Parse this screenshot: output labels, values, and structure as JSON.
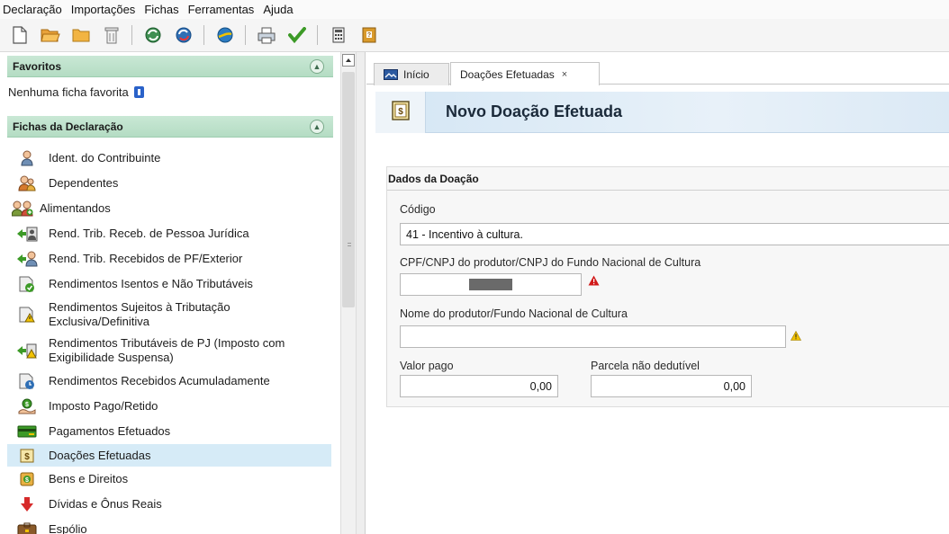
{
  "menu": [
    "Declaração",
    "Importações",
    "Fichas",
    "Ferramentas",
    "Ajuda"
  ],
  "toolbar": {
    "icons": [
      "new-file-icon",
      "open-folder-icon",
      "folder-icon",
      "trash-icon",
      "sync-icon",
      "sync-alt-icon",
      "transmit-icon",
      "print-icon",
      "check-icon",
      "calculator-icon",
      "help-book-icon"
    ]
  },
  "sidebar": {
    "favorites_header": "Favoritos",
    "favorites_empty": "Nenhuma ficha favorita",
    "fichas_header": "Fichas da Declaração",
    "items": [
      {
        "label": "Ident. do Contribuinte",
        "icon": "person-icon"
      },
      {
        "label": "Dependentes",
        "icon": "dependents-icon"
      },
      {
        "label": "Alimentandos",
        "icon": "alimentandos-icon"
      },
      {
        "label": "Rend. Trib. Receb. de Pessoa Jurídica",
        "icon": "income-pj-icon"
      },
      {
        "label": "Rend. Trib. Recebidos de PF/Exterior",
        "icon": "income-pf-icon"
      },
      {
        "label": "Rendimentos Isentos e Não Tributáveis",
        "icon": "exempt-income-icon"
      },
      {
        "label": "Rendimentos Sujeitos à Tributação Exclusiva/Definitiva",
        "icon": "exclusive-income-icon"
      },
      {
        "label": "Rendimentos Tributáveis de PJ (Imposto com Exigibilidade Suspensa)",
        "icon": "suspended-income-icon"
      },
      {
        "label": "Rendimentos Recebidos Acumuladamente",
        "icon": "accumulated-income-icon"
      },
      {
        "label": "Imposto Pago/Retido",
        "icon": "tax-paid-icon"
      },
      {
        "label": "Pagamentos Efetuados",
        "icon": "payments-icon"
      },
      {
        "label": "Doações Efetuadas",
        "icon": "donations-icon",
        "selected": true
      },
      {
        "label": "Bens e Direitos",
        "icon": "assets-icon"
      },
      {
        "label": "Dívidas e Ônus Reais",
        "icon": "debts-icon"
      },
      {
        "label": "Espólio",
        "icon": "estate-icon"
      }
    ]
  },
  "tabs": [
    {
      "label": "Início",
      "icon": "home-icon"
    },
    {
      "label": "Doações Efetuadas",
      "close": "×"
    }
  ],
  "page_title": "Novo Doação Efetuada",
  "panel": {
    "title": "Dados da Doação",
    "codigo_label": "Código",
    "codigo_value": "41 - Incentivo à cultura.",
    "cpf_label": "CPF/CNPJ do produtor/CNPJ do Fundo Nacional de Cultura",
    "cpf_value": "",
    "nome_label": "Nome do produtor/Fundo Nacional de Cultura",
    "nome_value": "",
    "valor_label": "Valor pago",
    "valor_value": "0,00",
    "parcela_label": "Parcela não dedutível",
    "parcela_value": "0,00"
  },
  "colors": {
    "sidebar_header": "#b9dfc7",
    "selected_item": "#d6ebf7",
    "title_band": "#d4e6f4",
    "error": "#d11a1a",
    "warning": "#f2c200"
  }
}
